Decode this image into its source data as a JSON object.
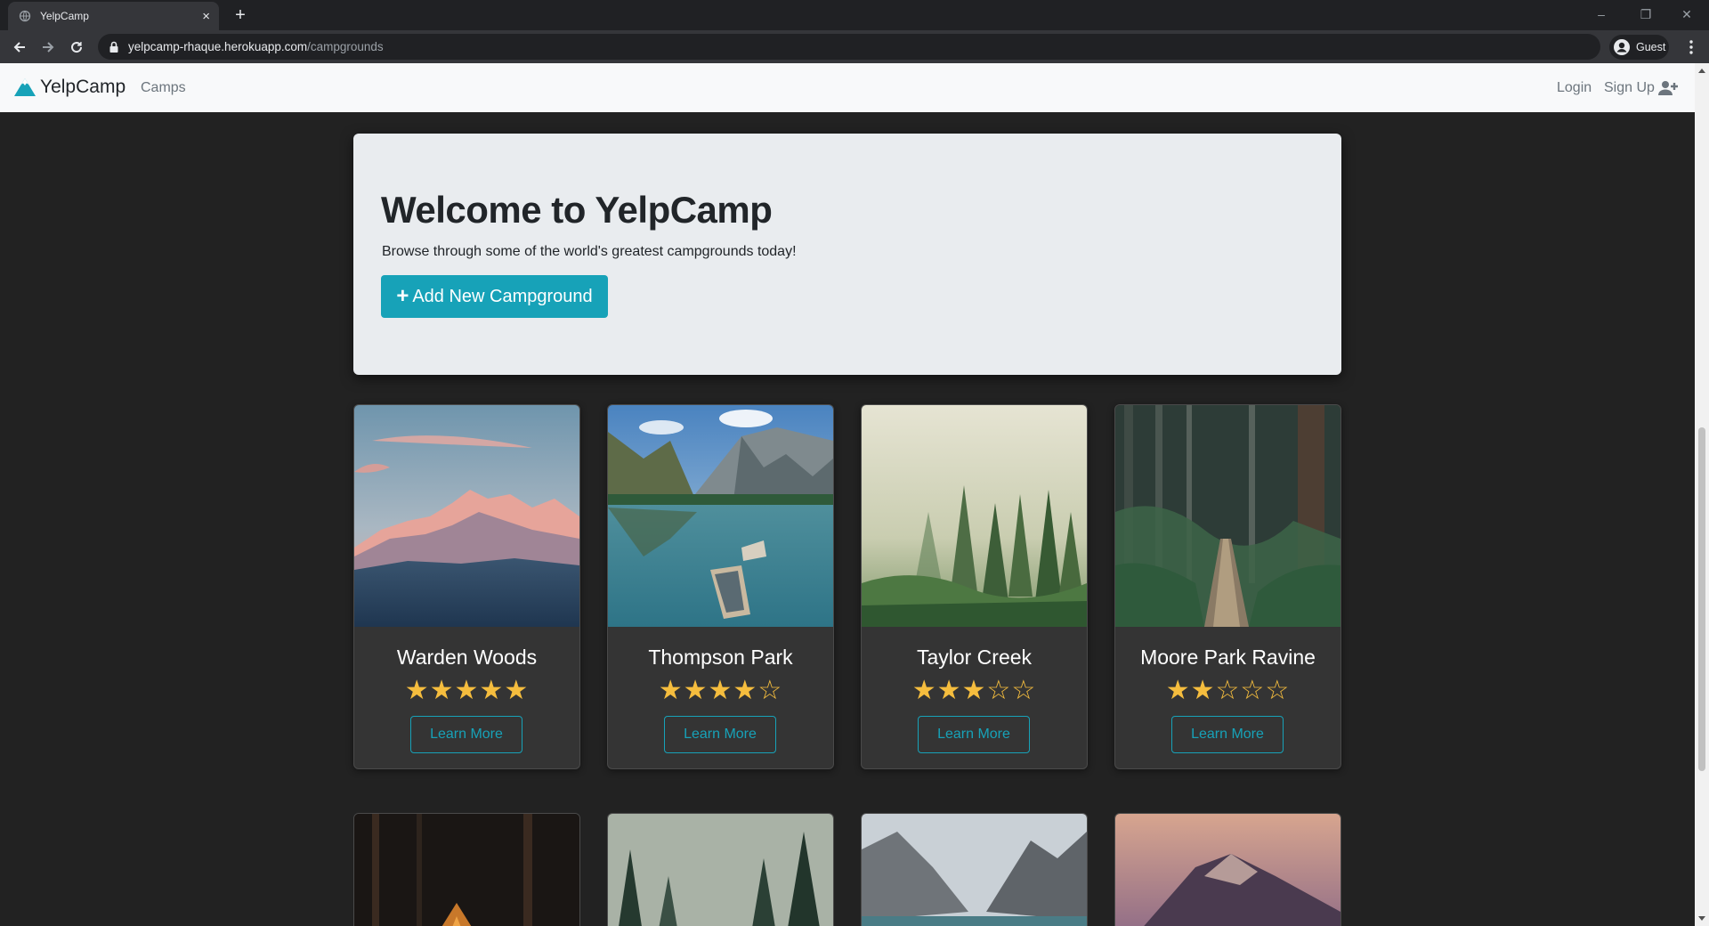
{
  "browser": {
    "tab_title": "YelpCamp",
    "tab_close": "×",
    "new_tab": "+",
    "url_host": "yelpcamp-rhaque.herokuapp.com",
    "url_path": "/campgrounds",
    "profile_label": "Guest",
    "window_controls": {
      "minimize": "–",
      "restore": "❐",
      "close": "✕"
    }
  },
  "navbar": {
    "brand": "YelpCamp",
    "camps": "Camps",
    "login": "Login",
    "signup": "Sign Up"
  },
  "jumbotron": {
    "title": "Welcome to YelpCamp",
    "lead": "Browse through some of the world's greatest campgrounds today!",
    "add_button": "Add New Campground",
    "add_icon": "+"
  },
  "campgrounds": [
    {
      "name": "Warden Woods",
      "rating": 5,
      "stars": "★★★★★",
      "button": "Learn More"
    },
    {
      "name": "Thompson Park",
      "rating": 4,
      "stars": "★★★★☆",
      "button": "Learn More"
    },
    {
      "name": "Taylor Creek",
      "rating": 3,
      "stars": "★★★☆☆",
      "button": "Learn More"
    },
    {
      "name": "Moore Park Ravine",
      "rating": 2,
      "stars": "★★☆☆☆",
      "button": "Learn More"
    }
  ],
  "icons": {
    "brand": "mountain-icon",
    "signup": "user-plus-icon",
    "add": "plus-icon",
    "rating": "star-icon"
  },
  "colors": {
    "accent": "#17a2b8",
    "star": "#f5bd3e",
    "page_bg": "#222222",
    "card_bg": "#343434",
    "jumbotron_bg": "#e9ecef"
  }
}
